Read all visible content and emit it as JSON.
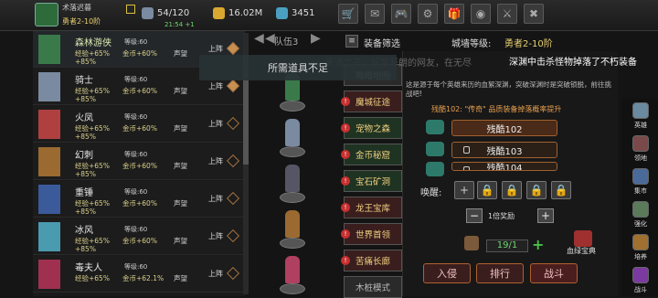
{
  "player": {
    "name": "术落迟暮",
    "rank": "勇者2-10阶",
    "energy": "54/120",
    "gold": "16.02M",
    "gems": "3451",
    "timer": "21:54 +1"
  },
  "toolbar": {
    "icons": [
      "shop-icon",
      "mail-icon",
      "gamepad-icon",
      "gear-icon",
      "gift-icon",
      "wheel-icon",
      "sword-icon",
      "crossed-swords-icon"
    ]
  },
  "heroes": [
    {
      "name": "森林游侠",
      "level": "等级:60",
      "exp": "经验+65%",
      "gold": "金币+60%",
      "fame": "声望",
      "exp2": "+85%",
      "deploy": "上阵",
      "active": true,
      "color": "#3a7a4a"
    },
    {
      "name": "骑士",
      "level": "等级:60",
      "exp": "经验+65%",
      "gold": "金币+60%",
      "fame": "声望",
      "exp2": "+85%",
      "deploy": "上阵",
      "active": true,
      "color": "#7a8aa0"
    },
    {
      "name": "火凤",
      "level": "等级:60",
      "exp": "经验+65%",
      "gold": "金币+60%",
      "fame": "声望",
      "exp2": "+85%",
      "deploy": "上阵",
      "active": false,
      "color": "#b04040"
    },
    {
      "name": "幻刺",
      "level": "等级:60",
      "exp": "经验+65%",
      "gold": "金币+60%",
      "fame": "声望",
      "exp2": "+85%",
      "deploy": "上阵",
      "active": false,
      "color": "#9a6a30"
    },
    {
      "name": "重锤",
      "level": "等级:60",
      "exp": "经验+65%",
      "gold": "金币+60%",
      "fame": "声望",
      "exp2": "+85%",
      "deploy": "上阵",
      "active": false,
      "color": "#3a5a9a"
    },
    {
      "name": "冰风",
      "level": "等级:60",
      "exp": "经验+65%",
      "gold": "金币+60%",
      "fame": "声望",
      "exp2": "+85%",
      "deploy": "上阵",
      "active": false,
      "color": "#4a9ab0"
    },
    {
      "name": "毒夫人",
      "level": "等级:60",
      "exp": "经验+65%",
      "gold": "金币+62.1%",
      "fame": "声望",
      "exp2": "",
      "deploy": "上阵",
      "active": false,
      "color": "#a03050"
    }
  ],
  "team": {
    "label": "队伍3",
    "filter": "装备筛选",
    "wall_rank": "城墙等级:",
    "wall_rank_value": "勇者2-10阶"
  },
  "dungeons": [
    "晦暗地图",
    "魔城征途",
    "宠物之森",
    "金币秘窟",
    "宝石矿洞",
    "龙王宝库",
    "世界首领",
    "苦痛长廊",
    "木桩模式"
  ],
  "toast": "所需道具不足",
  "marquee": "深渊中击杀怪物掉落了不朽装备",
  "bg_text": "天选之子，玩家开朗的网友，在无尽",
  "info": {
    "text": "这是源于每个英雄来历的血絮深渊，突破深渊时是突破锁脱，前往挑战吧!",
    "level_title": "残酷102: \"传奇\" 品质装备掉落概率提升",
    "levels": [
      "残酷102",
      "残酷103",
      "残酷104"
    ]
  },
  "awaken": {
    "label": "唤醒:",
    "multiplier": "1倍奖励"
  },
  "ticket": {
    "count": "19/1",
    "treasure": "血绿宝典"
  },
  "actions": [
    "入侵",
    "排行",
    "战斗"
  ],
  "sidebar": [
    "英雄",
    "领地",
    "集市",
    "强化",
    "培养",
    "战斗"
  ]
}
